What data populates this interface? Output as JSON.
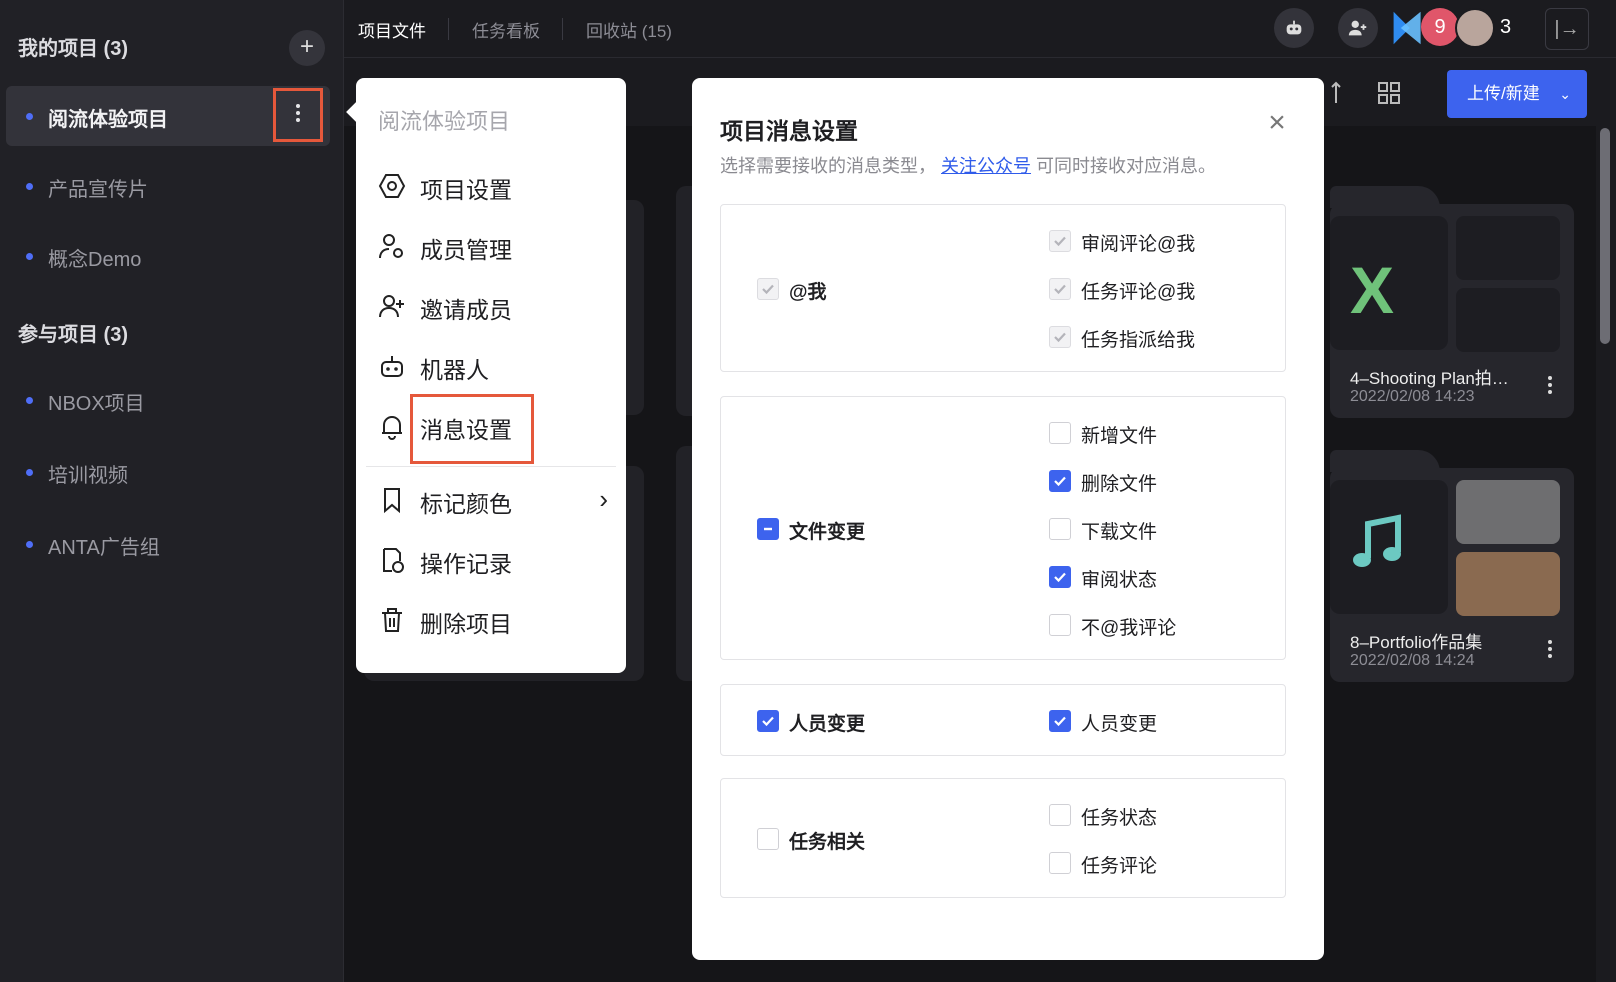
{
  "sidebar": {
    "my_projects_title": "我的项目 (3)",
    "my_projects": [
      {
        "label": "阅流体验项目",
        "active": true
      },
      {
        "label": "产品宣传片",
        "active": false
      },
      {
        "label": "概念Demo",
        "active": false
      }
    ],
    "joined_projects_title": "参与项目 (3)",
    "joined_projects": [
      {
        "label": "NBOX项目"
      },
      {
        "label": "培训视频"
      },
      {
        "label": "ANTA广告组"
      }
    ],
    "add_icon": "plus-icon",
    "more_icon": "vertical-ellipsis-icon"
  },
  "topbar": {
    "tabs": [
      {
        "label": "项目文件",
        "active": true
      },
      {
        "label": "任务看板",
        "active": false
      },
      {
        "label": "回收站 (15)",
        "active": false
      }
    ],
    "notification_badge": "9",
    "member_count": "3",
    "icons": [
      "robot-icon",
      "add-person-icon",
      "logo-icon",
      "avatar",
      "exit-icon"
    ]
  },
  "toolbar": {
    "upload_label": "上传/新建",
    "icons": [
      "sort-icon",
      "grid-view-icon",
      "chevron-down-icon"
    ]
  },
  "files": [
    {
      "name": "4–Shooting Plan拍…",
      "date": "2022/02/08 14:23",
      "type_icon": "excel-icon"
    },
    {
      "name": "8–Portfolio作品集",
      "date": "2022/02/08 14:24",
      "type_icon": "music-note-icon"
    }
  ],
  "project_menu": {
    "title": "阅流体验项目",
    "items": [
      {
        "label": "项目设置",
        "icon": "settings-hexagon-icon"
      },
      {
        "label": "成员管理",
        "icon": "member-settings-icon"
      },
      {
        "label": "邀请成员",
        "icon": "add-person-icon"
      },
      {
        "label": "机器人",
        "icon": "robot-icon"
      },
      {
        "label": "消息设置",
        "icon": "bell-icon",
        "highlighted": true
      },
      {
        "label": "标记颜色",
        "icon": "bookmark-icon",
        "has_submenu": true
      },
      {
        "label": "操作记录",
        "icon": "history-icon"
      },
      {
        "label": "删除项目",
        "icon": "trash-icon"
      }
    ]
  },
  "message_settings": {
    "title": "项目消息设置",
    "subtitle_prefix": "选择需要接收的消息类型，",
    "subtitle_link": "关注公众号",
    "subtitle_suffix": "可同时接收对应消息。",
    "close_icon": "close-icon",
    "groups": [
      {
        "label": "@我",
        "state": "checked-disabled",
        "options": [
          {
            "label": "审阅评论@我",
            "state": "checked-disabled"
          },
          {
            "label": "任务评论@我",
            "state": "checked-disabled"
          },
          {
            "label": "任务指派给我",
            "state": "checked-disabled"
          }
        ]
      },
      {
        "label": "文件变更",
        "state": "indeterminate",
        "options": [
          {
            "label": "新增文件",
            "state": "unchecked"
          },
          {
            "label": "删除文件",
            "state": "checked"
          },
          {
            "label": "下载文件",
            "state": "unchecked"
          },
          {
            "label": "审阅状态",
            "state": "checked"
          },
          {
            "label": "不@我评论",
            "state": "unchecked"
          }
        ]
      },
      {
        "label": "人员变更",
        "state": "checked",
        "options": [
          {
            "label": "人员变更",
            "state": "checked"
          }
        ]
      },
      {
        "label": "任务相关",
        "state": "unchecked",
        "options": [
          {
            "label": "任务状态",
            "state": "unchecked"
          },
          {
            "label": "任务评论",
            "state": "unchecked"
          }
        ]
      }
    ]
  },
  "colors": {
    "accent": "#3d63ee",
    "highlight_border": "#e5583b",
    "badge": "#e0566a"
  }
}
